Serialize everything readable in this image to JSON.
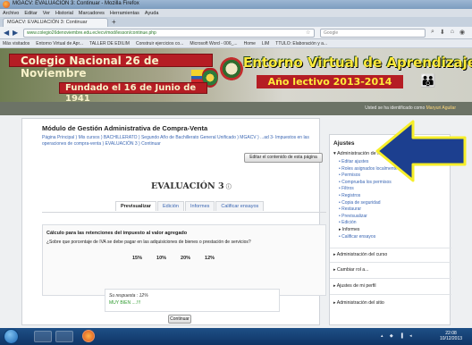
{
  "window": {
    "title": "MGACV: EVALUACIÓN 3: Continuar - Mozilla Firefox"
  },
  "menubar": [
    "Archivo",
    "Editar",
    "Ver",
    "Historial",
    "Marcadores",
    "Herramientas",
    "Ayuda"
  ],
  "tab": {
    "label": "MGACV: EVALUACIÓN 3: Continuar"
  },
  "address": {
    "url": "www.colegio26denoviembre.edu.ec/ecv/mod/lesson/continue.php",
    "search_placeholder": "Google"
  },
  "bookmarks": [
    "Más visitados",
    "Entorno Virtual de Apr...",
    "TALLER DE EDILIM",
    "Construir ejercicios co...",
    "Microsoft Word - 006_...",
    "Home",
    "LIM",
    "TTULO: Elaboración y a..."
  ],
  "banner": {
    "school": "Colegio Nacional 26 de Noviembre",
    "founded": "Fundado el 16 de Junio de 1941",
    "platform": "Entorno Virtual de Aprendizaje",
    "year": "Año lectivo 2013-2014"
  },
  "login": {
    "prefix": "Usted se ha identificado como",
    "user": "Maryuri Aguilar"
  },
  "main": {
    "module_title": "Módulo de Gestión Administrativa de Compra-Venta",
    "breadcrumb": "Página Principal ) Mis cursos ) BACHILLERATO ) Segundo Año de Bachillerato General Unificado ) MGACV ) ...ad 3- Impuestos en las operaciones de compra-venta ) EVALUACIÓN 3 ) Continuar",
    "edit_button": "Editar el contenido de esta página",
    "eval_title": "EVALUACIÓN 3",
    "tabs": [
      "Previsualizar",
      "Edición",
      "Informes",
      "Calificar ensayos"
    ],
    "question_title": "Cálculo para las retenciones del impuesto al valor agregado",
    "question_text": "¿Sobre que porcentaje de IVA se debe pagar en las adquisiciones de bienes o prestación de servicios?",
    "options": [
      "15%",
      "10%",
      "20%",
      "12%"
    ],
    "answer_label": "Su respuesta : 12%",
    "answer_feedback": "MUY BIEN ....!!!",
    "continue_button": "Continuar"
  },
  "sidebar": {
    "title": "Ajustes",
    "section": "Administración de la lección",
    "items": [
      "Editar ajustes",
      "Roles asignados localmente",
      "Permisos",
      "Comprueba los permisos",
      "Filtros",
      "Registros",
      "Copia de seguridad",
      "Restaurar",
      "Previsualizar",
      "Edición",
      "Informes",
      "Calificar ensayos"
    ],
    "blocks": [
      "Administración del curso",
      "Cambiar rol a...",
      "Ajustes de mi perfil",
      "Administración del sitio"
    ]
  },
  "taskbar": {
    "time": "22:08",
    "date": "10/12/2013"
  },
  "colors": {
    "accent_red": "#b51d24",
    "banner_yellow": "#ffea3b",
    "arrow_yellow": "#f6ee2a",
    "arrow_blue": "#1c3f8f"
  }
}
